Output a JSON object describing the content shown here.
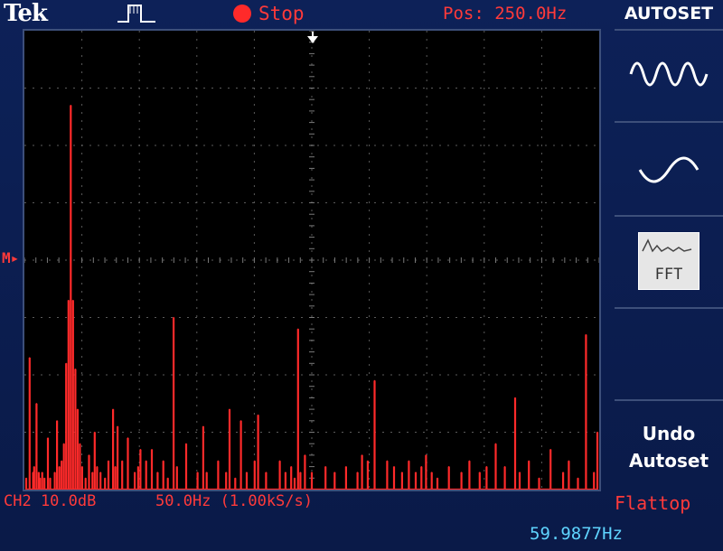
{
  "header": {
    "brand": "Tek",
    "trigger_icon": "pulse-trigger-icon",
    "run_state": "Stop",
    "position": "Pos: 250.0Hz"
  },
  "side_menu": {
    "title": "AUTOSET",
    "options": [
      {
        "name": "multi-cycle-sine-icon"
      },
      {
        "name": "single-cycle-sine-icon"
      },
      {
        "label": "FFT",
        "icon": "fft-icon"
      },
      {
        "label_line1": "Undo",
        "label_line2": "Autoset"
      }
    ]
  },
  "display": {
    "ref_marker": "M▸",
    "channel_scale": "CH2 10.0dB",
    "freq_scale": "50.0Hz (1.00kS/s)",
    "window": "Flattop",
    "measured_frequency": "59.9877Hz"
  },
  "chart_data": {
    "type": "line",
    "xlabel": "",
    "ylabel": "",
    "grid": true,
    "divisions": {
      "x": 10,
      "y": 8
    },
    "xlim": [
      0,
      500
    ],
    "ylim": [
      0,
      8
    ],
    "series": [
      {
        "color": "#ff2a2a",
        "x": [
          0,
          3,
          6,
          7,
          9,
          11,
          12,
          14,
          16,
          19,
          21,
          25,
          27,
          29,
          31,
          33,
          35,
          37,
          39,
          41,
          43,
          45,
          47,
          49,
          52,
          55,
          58,
          60,
          62,
          65,
          69,
          72,
          76,
          78,
          80,
          84,
          89,
          95,
          98,
          100,
          105,
          110,
          115,
          120,
          124,
          129,
          132,
          140,
          150,
          155,
          158,
          168,
          175,
          178,
          183,
          188,
          193,
          200,
          203,
          210,
          222,
          227,
          232,
          235,
          238,
          240,
          244,
          250,
          262,
          270,
          280,
          290,
          294,
          299,
          305,
          316,
          322,
          329,
          335,
          341,
          346,
          350,
          355,
          360,
          370,
          381,
          388,
          397,
          403,
          411,
          419,
          428,
          432,
          440,
          449,
          459,
          470,
          475,
          483,
          490,
          497,
          500
        ],
        "y": [
          0.2,
          2.3,
          0.3,
          0.4,
          1.5,
          0.3,
          0.2,
          0.3,
          0.2,
          0.9,
          0.2,
          0.3,
          1.2,
          0.4,
          0.5,
          0.8,
          2.2,
          3.3,
          6.7,
          3.3,
          2.1,
          1.4,
          0.8,
          0.4,
          0.2,
          0.6,
          0.3,
          1.0,
          0.4,
          0.3,
          0.2,
          0.5,
          1.4,
          0.4,
          1.1,
          0.5,
          0.9,
          0.3,
          0.4,
          0.7,
          0.5,
          0.7,
          0.3,
          0.5,
          0.2,
          3.0,
          0.4,
          0.8,
          0.3,
          1.1,
          0.3,
          0.5,
          0.3,
          1.4,
          0.2,
          1.2,
          0.3,
          0.5,
          1.3,
          0.3,
          0.5,
          0.3,
          0.4,
          0.2,
          2.8,
          0.3,
          0.6,
          0.3,
          0.4,
          0.3,
          0.4,
          0.3,
          0.6,
          0.5,
          1.9,
          0.5,
          0.4,
          0.3,
          0.5,
          0.3,
          0.4,
          0.6,
          0.3,
          0.2,
          0.4,
          0.3,
          0.5,
          0.3,
          0.4,
          0.8,
          0.4,
          1.6,
          0.3,
          0.5,
          0.2,
          0.7,
          0.3,
          0.5,
          0.2,
          2.7,
          0.3,
          1.0
        ]
      }
    ]
  }
}
